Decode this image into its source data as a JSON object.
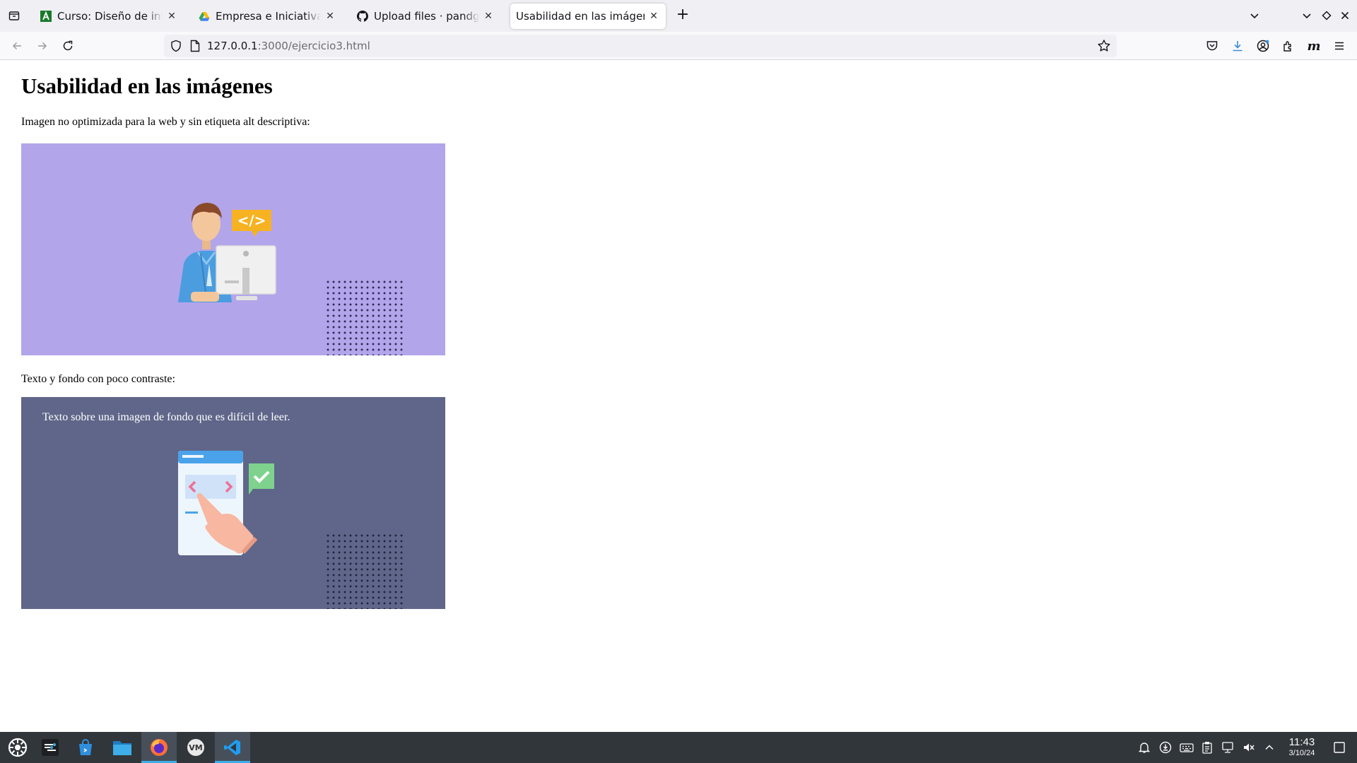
{
  "browser": {
    "tabs": [
      {
        "title": "Curso: Diseño de interfaces",
        "favicon": "a-letter-icon",
        "active": false
      },
      {
        "title": "Empresa e Iniciativa Emprendedora",
        "favicon": "google-drive-icon",
        "active": false
      },
      {
        "title": "Upload files · pandgri/Usabilidad",
        "favicon": "github-icon",
        "active": false
      },
      {
        "title": "Usabilidad en las imágenes",
        "favicon": "",
        "active": true
      }
    ],
    "url_host": "127.0.0.1",
    "url_rest": ":3000/ejercicio3.html"
  },
  "page": {
    "title": "Usabilidad en las imágenes",
    "para1": "Imagen no optimizada para la web y sin etiqueta alt descriptiva:",
    "para2": "Texto y fondo con poco contraste:",
    "image2_text": "Texto sobre una imagen de fondo que es difícil de leer.",
    "image1_bg": "#b3a5ea",
    "image2_bg": "#5f6689"
  },
  "taskbar": {
    "time": "11:43",
    "date": "3/10/24",
    "accent": "#3daee9"
  }
}
